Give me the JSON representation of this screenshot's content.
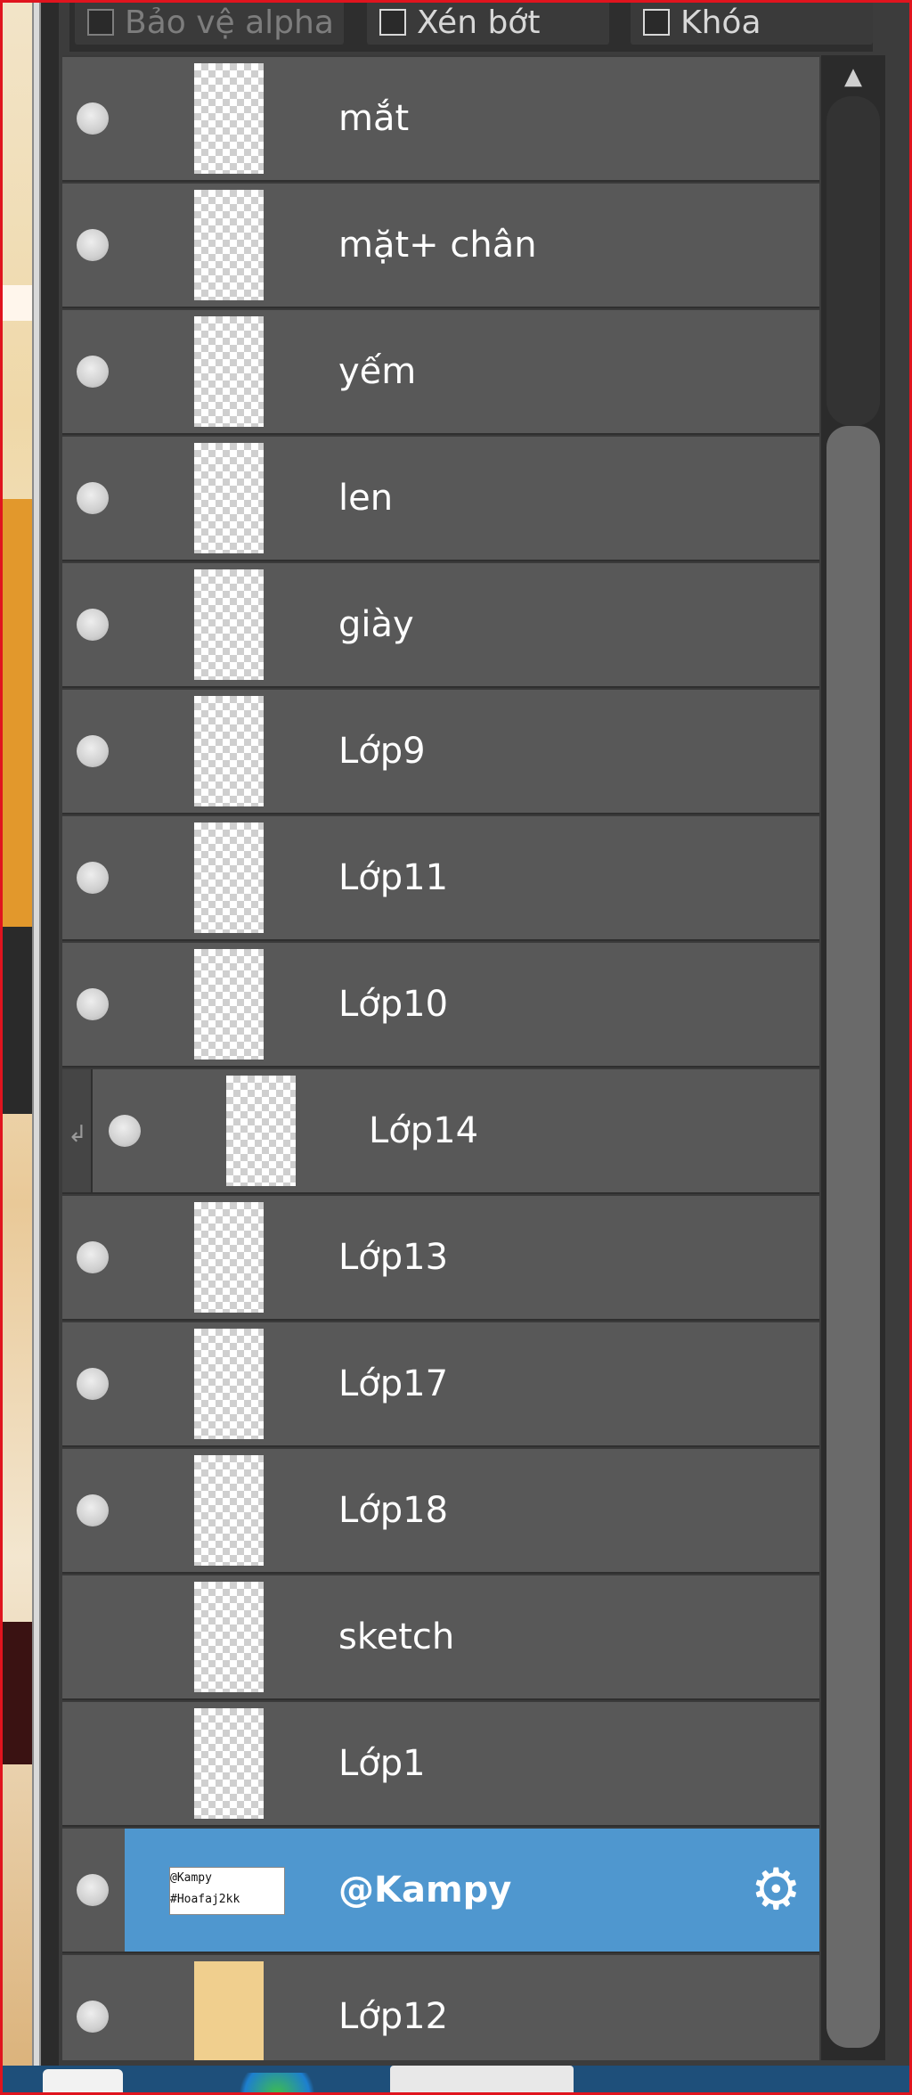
{
  "options": {
    "protect_alpha": "Bảo vệ alpha",
    "clip": "Xén bớt",
    "lock": "Khóa"
  },
  "layers": [
    {
      "name": "mắt"
    },
    {
      "name": "mặt+ chân"
    },
    {
      "name": "yếm"
    },
    {
      "name": "len"
    },
    {
      "name": "giày"
    },
    {
      "name": "Lớp9"
    },
    {
      "name": "Lớp11"
    },
    {
      "name": "Lớp10"
    },
    {
      "name": "Lớp14"
    },
    {
      "name": "Lớp13"
    },
    {
      "name": "Lớp17"
    },
    {
      "name": "Lớp18"
    },
    {
      "name": "sketch"
    },
    {
      "name": "Lớp1"
    },
    {
      "name": "@Kampy",
      "thumb_text": "@Kampy\n#Hoafaj2kk"
    },
    {
      "name": "Lớp12"
    }
  ],
  "colors": {
    "selected": "#4f97cf",
    "row": "#585858",
    "frame": "#e0141e"
  },
  "icons": [
    "visibility-icon",
    "clip-arrow-icon",
    "gear-icon",
    "scroll-up-icon"
  ]
}
